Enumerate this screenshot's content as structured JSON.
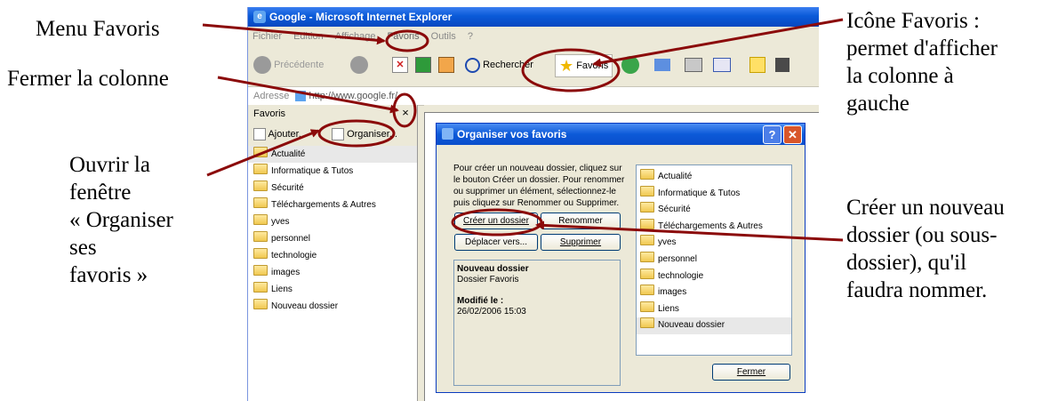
{
  "annotations": {
    "menu_favoris": "Menu Favoris",
    "fermer_colonne": "Fermer la colonne",
    "ouvrir_fenetre_lines": [
      "Ouvrir la",
      "fenêtre",
      "« Organiser",
      "ses",
      "favoris »"
    ],
    "icone_favoris_lines": [
      "Icône Favoris :",
      "permet d'afficher",
      "la colonne à",
      "gauche"
    ],
    "creer_dossier_lines": [
      "Créer un nouveau",
      "dossier (ou sous-",
      "dossier), qu'il",
      "faudra nommer."
    ]
  },
  "browser": {
    "title": "Google - Microsoft Internet Explorer",
    "menu": [
      "Fichier",
      "Edition",
      "Affichage",
      "Favoris",
      "Outils",
      "?"
    ],
    "toolbar": {
      "back_label": "Précédente",
      "search_label": "Rechercher",
      "favorites_label": "Favoris"
    },
    "address_label": "Adresse",
    "address_value": "http://www.google.fr/"
  },
  "sidebar": {
    "title": "Favoris",
    "add_label": "Ajouter...",
    "organize_label": "Organiser...",
    "items": [
      "Actualité",
      "Informatique & Tutos",
      "Sécurité",
      "Téléchargements & Autres",
      "yves",
      "personnel",
      "technologie",
      "images",
      "Liens",
      "Nouveau dossier"
    ]
  },
  "dialog": {
    "title": "Organiser vos favoris",
    "help": "?",
    "description": "Pour créer un nouveau dossier, cliquez sur le bouton Créer un dossier. Pour renommer ou supprimer un élément, sélectionnez-le puis cliquez sur Renommer ou Supprimer.",
    "create_folder": "Créer un dossier",
    "rename": "Renommer",
    "move_to": "Déplacer vers...",
    "delete": "Supprimer",
    "info_name": "Nouveau dossier",
    "info_type": "Dossier Favoris",
    "info_modified_label": "Modifié le :",
    "info_modified_value": "26/02/2006 15:03",
    "folders": [
      "Actualité",
      "Informatique & Tutos",
      "Sécurité",
      "Téléchargements & Autres",
      "yves",
      "personnel",
      "technologie",
      "images",
      "Liens",
      "Nouveau dossier"
    ],
    "close": "Fermer"
  },
  "colors": {
    "annotation_stroke": "#8b0a0a",
    "xp_blue": "#0a5ad8"
  }
}
